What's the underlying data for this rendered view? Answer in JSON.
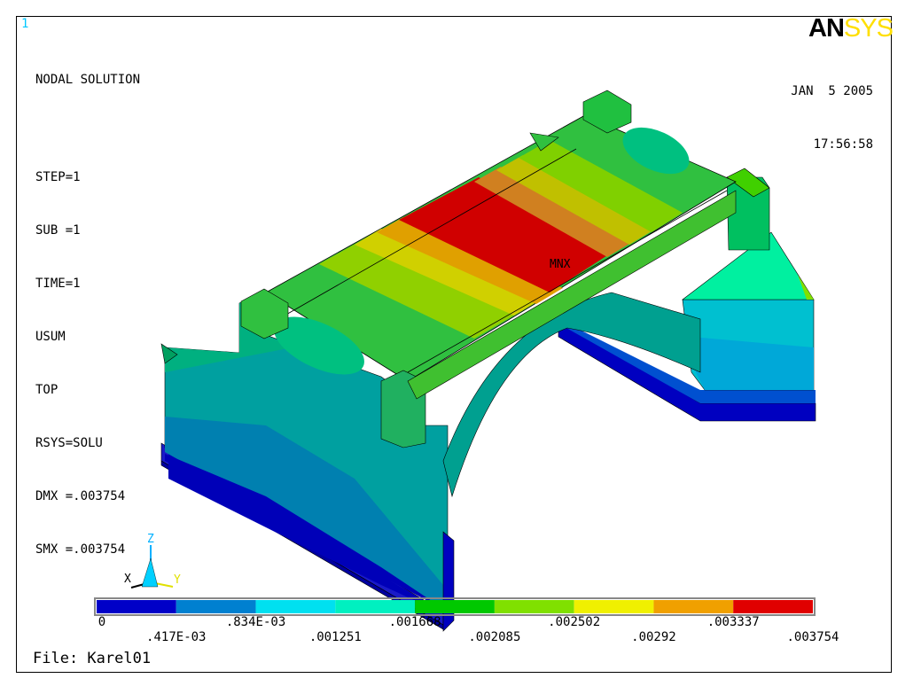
{
  "window_number": "1",
  "plot_title": "NODAL SOLUTION",
  "info_lines": [
    "STEP=1",
    "SUB =1",
    "TIME=1",
    "USUM",
    "TOP",
    "RSYS=SOLU",
    "DMX =.003754",
    "SMX =.003754"
  ],
  "date": "JAN  5 2005",
  "time": "17:56:58",
  "logo": {
    "part1": "AN",
    "part2": "SYS"
  },
  "file_label": "File: Karel01",
  "max_marker": "MNX",
  "axes": {
    "x": "X",
    "y": "Y",
    "z": "Z"
  },
  "legend": {
    "colors": [
      "#0000c8",
      "#0080d0",
      "#00e0f0",
      "#00f0c0",
      "#00c800",
      "#80e000",
      "#f0f000",
      "#f0a000",
      "#e00000"
    ],
    "values_lower": [
      "0",
      ".834E-03",
      ".001668",
      ".002502",
      ".003337"
    ],
    "values_upper": [
      ".417E-03",
      ".001251",
      ".002085",
      ".00292",
      ".003754"
    ]
  }
}
